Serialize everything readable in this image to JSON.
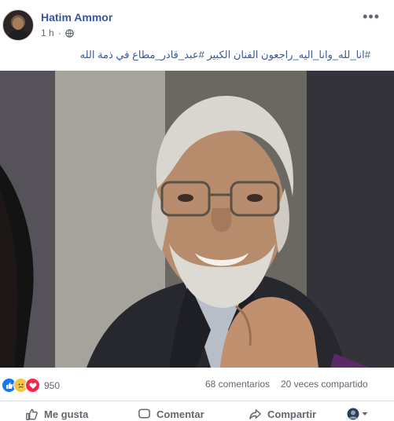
{
  "post": {
    "author": "Hatim Ammor",
    "time": "1 h",
    "text": "#انا_لله_وانا_اليه_راجعون الفنان الكبير #عبد_قادر_مطاع في ذمة الله"
  },
  "stats": {
    "reaction_count": "950",
    "comments": "68 comentarios",
    "shares": "20 veces compartido"
  },
  "actions": {
    "like": "Me gusta",
    "comment": "Comentar",
    "share": "Compartir"
  },
  "icons": [
    "globe-icon",
    "more-options-icon",
    "like-reaction-icon",
    "sad-reaction-icon",
    "love-reaction-icon",
    "thumbs-up-icon",
    "comment-icon",
    "share-icon",
    "caret-down-icon"
  ],
  "colors": {
    "author_link": "#385898",
    "secondary_text": "#606770",
    "like_blue": "#1877f2",
    "love_red": "#f0284a",
    "sad_yellow": "#f7c44a"
  }
}
